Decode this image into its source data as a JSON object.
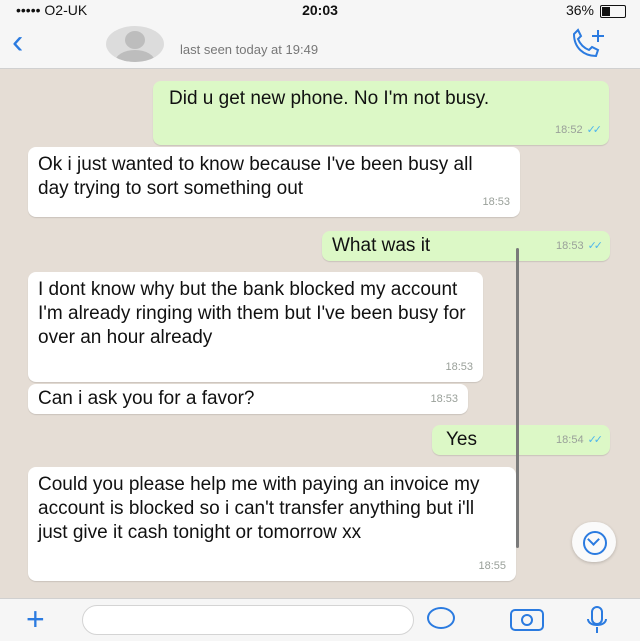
{
  "status_bar": {
    "carrier": "••••• O2-UK",
    "time": "20:03",
    "battery": "36%"
  },
  "header": {
    "back_icon": "chevron-left-icon",
    "last_seen": "last seen today at 19:49",
    "call_icon": "add-call-icon"
  },
  "messages": [
    {
      "direction": "out",
      "text": "Did u get new phone. No I'm not busy.",
      "time": "18:52",
      "ticks": "✓✓"
    },
    {
      "direction": "in",
      "text": "Ok i just wanted to know because I've been busy all day trying to sort something out",
      "time": "18:53"
    },
    {
      "direction": "out",
      "text": "What was it",
      "time": "18:53",
      "ticks": "✓✓"
    },
    {
      "direction": "in",
      "text": "I dont know why but the bank blocked my account I'm already ringing with them but I've been busy for over an hour already",
      "time": "18:53"
    },
    {
      "direction": "in",
      "text": "Can i ask you for a favor?",
      "time": "18:53"
    },
    {
      "direction": "out",
      "text": "Yes",
      "time": "18:54",
      "ticks": "✓✓"
    },
    {
      "direction": "in",
      "text": "Could you please help me with paying an invoice my account is blocked so i can't transfer anything but i'll just give it cash tonight or tomorrow xx",
      "time": "18:55"
    }
  ],
  "input_bar": {
    "plus_icon": "plus-icon",
    "sticker_icon": "sticker-icon",
    "camera_icon": "camera-icon",
    "mic_icon": "microphone-icon"
  },
  "colors": {
    "background": "#e5ddd5",
    "outgoing_bubble": "#dcf8c6",
    "incoming_bubble": "#ffffff",
    "accent": "#2b7be0",
    "read_ticks": "#4fb6ec"
  }
}
